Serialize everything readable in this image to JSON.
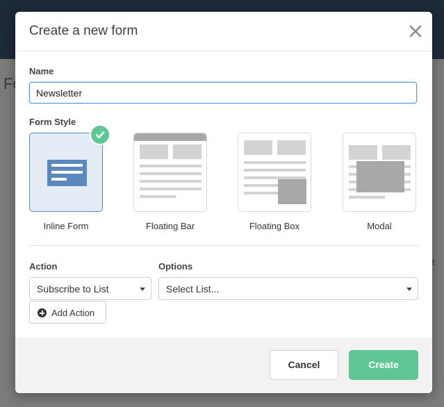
{
  "background": {
    "partial_left_text": "Fo",
    "partial_right_text": "t"
  },
  "modal": {
    "title": "Create a new form",
    "close_icon": "close-icon"
  },
  "name_section": {
    "label": "Name",
    "value": "Newsletter"
  },
  "form_style": {
    "label": "Form Style",
    "options": [
      {
        "label": "Inline Form",
        "selected": true,
        "icon": "inline-form-icon"
      },
      {
        "label": "Floating Bar",
        "selected": false,
        "icon": "floating-bar-icon"
      },
      {
        "label": "Floating Box",
        "selected": false,
        "icon": "floating-box-icon"
      },
      {
        "label": "Modal",
        "selected": false,
        "icon": "modal-icon"
      }
    ]
  },
  "action": {
    "label": "Action",
    "selected": "Subscribe to List"
  },
  "options": {
    "label": "Options",
    "selected": "Select List..."
  },
  "add_action_label": "Add Action",
  "footer": {
    "cancel_label": "Cancel",
    "create_label": "Create"
  },
  "colors": {
    "accent_green": "#5ec795",
    "selected_border": "#5f87b4",
    "selected_bg": "#e4ebf5",
    "input_focus": "#5b9fd6",
    "inline_icon_blue": "#5b89bf"
  }
}
